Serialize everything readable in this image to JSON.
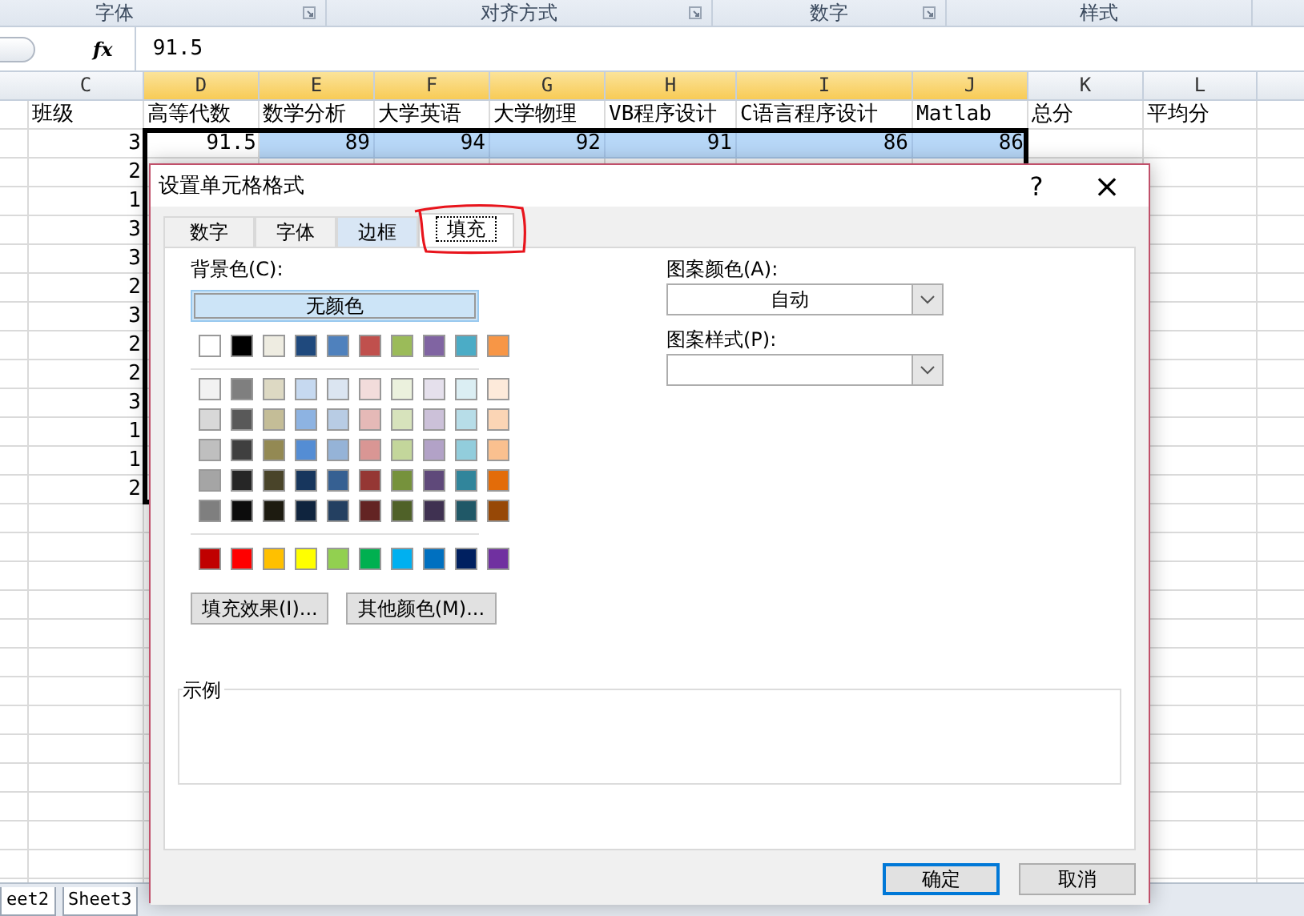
{
  "ribbon_groups": [
    {
      "label": "字体",
      "launcher": true
    },
    {
      "label": "对齐方式",
      "launcher": true
    },
    {
      "label": "数字",
      "launcher": true
    },
    {
      "label": "样式",
      "launcher": false
    }
  ],
  "formula_bar": {
    "fx": "fx",
    "value": "91.5"
  },
  "columns": [
    {
      "label": "C",
      "selected": false
    },
    {
      "label": "D",
      "selected": true
    },
    {
      "label": "E",
      "selected": true
    },
    {
      "label": "F",
      "selected": true
    },
    {
      "label": "G",
      "selected": true
    },
    {
      "label": "H",
      "selected": true
    },
    {
      "label": "I",
      "selected": true
    },
    {
      "label": "J",
      "selected": true
    },
    {
      "label": "K",
      "selected": false
    },
    {
      "label": "L",
      "selected": false
    }
  ],
  "header_row": [
    "班级",
    "高等代数",
    "数学分析",
    "大学英语",
    "大学物理",
    "VB程序设计",
    "C语言程序设计",
    "Matlab",
    "总分",
    "平均分"
  ],
  "first_row": [
    {
      "text": "3",
      "selected": false
    },
    {
      "text": "91.5",
      "selected": false
    },
    {
      "text": "89",
      "selected": true
    },
    {
      "text": "94",
      "selected": true
    },
    {
      "text": "92",
      "selected": true
    },
    {
      "text": "91",
      "selected": true
    },
    {
      "text": "86",
      "selected": true
    },
    {
      "text": "86",
      "selected": true
    }
  ],
  "class_values": [
    "2",
    "1",
    "3",
    "3",
    "2",
    "3",
    "2",
    "2",
    "3",
    "1",
    "1",
    "2"
  ],
  "sheet_tabs": [
    {
      "label": "eet2",
      "selected": false
    },
    {
      "label": "Sheet3",
      "selected": false
    }
  ],
  "dialog": {
    "title": "设置单元格格式",
    "help": "?",
    "close": "×",
    "tabs": [
      {
        "label": "数字",
        "selected": false,
        "hover": false
      },
      {
        "label": "字体",
        "selected": false,
        "hover": false
      },
      {
        "label": "边框",
        "selected": false,
        "hover": true
      },
      {
        "label": "填充",
        "selected": true,
        "hover": false
      }
    ],
    "background_label": "背景色(C):",
    "no_color": "无颜色",
    "theme_colors": [
      {
        "color": "#ffffff"
      },
      {
        "color": "#000000"
      },
      {
        "color": "#eeece1"
      },
      {
        "color": "#1f497d"
      },
      {
        "color": "#4f81bd"
      },
      {
        "color": "#c0504d"
      },
      {
        "color": "#9bbb59"
      },
      {
        "color": "#8064a2"
      },
      {
        "color": "#4bacc6"
      },
      {
        "color": "#f79646"
      }
    ],
    "tint_rows": [
      [
        {
          "color": "#f2f2f2"
        },
        {
          "color": "#7f7f7f"
        },
        {
          "color": "#ddd9c3"
        },
        {
          "color": "#c6d9f0"
        },
        {
          "color": "#dbe5f1"
        },
        {
          "color": "#f2dcdb"
        },
        {
          "color": "#ebf1dd"
        },
        {
          "color": "#e5e0ec"
        },
        {
          "color": "#dbeef3"
        },
        {
          "color": "#fdeada"
        }
      ],
      [
        {
          "color": "#d8d8d8"
        },
        {
          "color": "#595959"
        },
        {
          "color": "#c4bd97"
        },
        {
          "color": "#8db3e2"
        },
        {
          "color": "#b8cce4"
        },
        {
          "color": "#e5b9b7"
        },
        {
          "color": "#d7e3bc"
        },
        {
          "color": "#ccc1d9"
        },
        {
          "color": "#b7dde8"
        },
        {
          "color": "#fbd5b5"
        }
      ],
      [
        {
          "color": "#bfbfbf"
        },
        {
          "color": "#3f3f3f"
        },
        {
          "color": "#938953"
        },
        {
          "color": "#548dd4"
        },
        {
          "color": "#95b3d7"
        },
        {
          "color": "#d99694"
        },
        {
          "color": "#c3d69b"
        },
        {
          "color": "#b2a2c7"
        },
        {
          "color": "#92cddc"
        },
        {
          "color": "#fac08f"
        }
      ],
      [
        {
          "color": "#a5a5a5"
        },
        {
          "color": "#262626"
        },
        {
          "color": "#494429"
        },
        {
          "color": "#17365d"
        },
        {
          "color": "#366092"
        },
        {
          "color": "#953734"
        },
        {
          "color": "#76923c"
        },
        {
          "color": "#5f497a"
        },
        {
          "color": "#31859b"
        },
        {
          "color": "#e36c09"
        }
      ],
      [
        {
          "color": "#7f7f7f"
        },
        {
          "color": "#0c0c0c"
        },
        {
          "color": "#1d1b10"
        },
        {
          "color": "#0f243e"
        },
        {
          "color": "#244061"
        },
        {
          "color": "#632423"
        },
        {
          "color": "#4f6128"
        },
        {
          "color": "#3f3151"
        },
        {
          "color": "#205867"
        },
        {
          "color": "#974806"
        }
      ]
    ],
    "standard_colors": [
      {
        "color": "#c00000"
      },
      {
        "color": "#ff0000"
      },
      {
        "color": "#ffc000"
      },
      {
        "color": "#ffff00"
      },
      {
        "color": "#92d050"
      },
      {
        "color": "#00b050"
      },
      {
        "color": "#00b0f0"
      },
      {
        "color": "#0070c0"
      },
      {
        "color": "#002060"
      },
      {
        "color": "#7030a0"
      }
    ],
    "fill_effects_button": "填充效果(I)...",
    "more_colors_button": "其他颜色(M)...",
    "pattern_color_label": "图案颜色(A):",
    "pattern_color_value": "自动",
    "pattern_style_label": "图案样式(P):",
    "sample_label": "示例",
    "ok_button": "确定",
    "cancel_button": "取消"
  }
}
